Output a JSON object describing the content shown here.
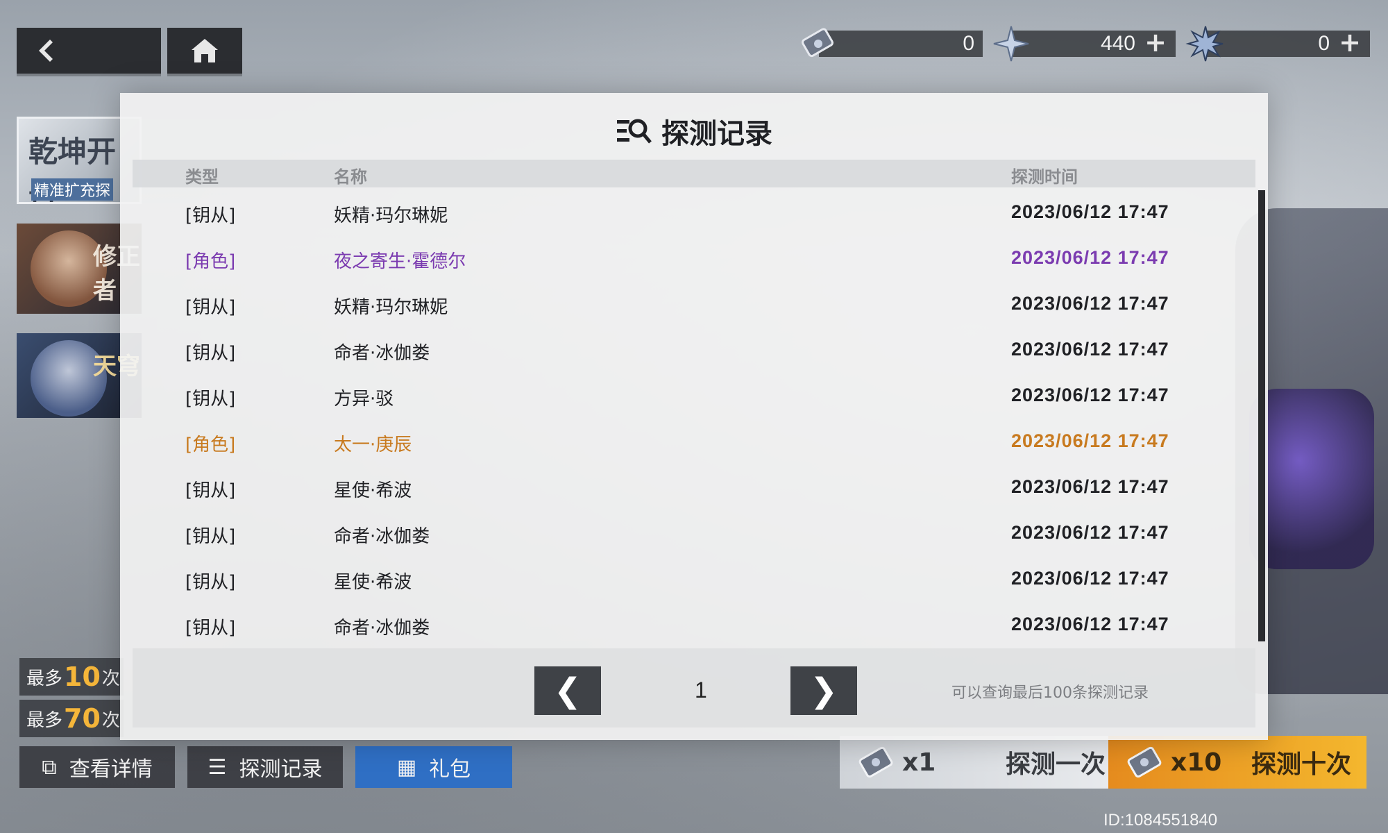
{
  "currencies": [
    {
      "icon": "ticket-icon",
      "amount": "0",
      "has_plus": false
    },
    {
      "icon": "star-crystal-icon",
      "amount": "440",
      "has_plus": true
    },
    {
      "icon": "snowflake-crystal-icon",
      "amount": "0",
      "has_plus": true
    }
  ],
  "banners": {
    "banner1_title": "乾坤开吾",
    "banner1_sub": "精准扩充探",
    "banner2_label": "修正者",
    "banner3_label": "天穹"
  },
  "limits": [
    {
      "prefix": "最多",
      "num": "10",
      "suffix": "次"
    },
    {
      "prefix": "最多",
      "num": "70",
      "suffix": "次"
    }
  ],
  "modal": {
    "title": "探测记录",
    "headers": {
      "type": "类型",
      "name": "名称",
      "time": "探测时间"
    },
    "rows": [
      {
        "type": "[钥从]",
        "name": "妖精·玛尔琳妮",
        "time": "2023/06/12 17:47",
        "color": "default"
      },
      {
        "type": "[角色]",
        "name": "夜之寄生·霍德尔",
        "time": "2023/06/12 17:47",
        "color": "purple"
      },
      {
        "type": "[钥从]",
        "name": "妖精·玛尔琳妮",
        "time": "2023/06/12 17:47",
        "color": "default"
      },
      {
        "type": "[钥从]",
        "name": "命者·冰伽娄",
        "time": "2023/06/12 17:47",
        "color": "default"
      },
      {
        "type": "[钥从]",
        "name": "方异·驳",
        "time": "2023/06/12 17:47",
        "color": "default"
      },
      {
        "type": "[角色]",
        "name": "太一·庚辰",
        "time": "2023/06/12 17:47",
        "color": "orange"
      },
      {
        "type": "[钥从]",
        "name": "星使·希波",
        "time": "2023/06/12 17:47",
        "color": "default"
      },
      {
        "type": "[钥从]",
        "name": "命者·冰伽娄",
        "time": "2023/06/12 17:47",
        "color": "default"
      },
      {
        "type": "[钥从]",
        "name": "星使·希波",
        "time": "2023/06/12 17:47",
        "color": "default"
      },
      {
        "type": "[钥从]",
        "name": "命者·冰伽娄",
        "time": "2023/06/12 17:47",
        "color": "default"
      }
    ],
    "pager": {
      "prev": "❮",
      "next": "❯",
      "page": "1",
      "hint": "可以查询最后100条探测记录"
    }
  },
  "bottom": {
    "detail_label": "查看详情",
    "record_label": "探测记录",
    "gift_label": "礼包",
    "draw_once_count": "x1",
    "draw_once_label": "探测一次",
    "draw_ten_count": "x10",
    "draw_ten_label": "探测十次"
  },
  "user_id": "ID:1084551840",
  "colors": {
    "purple": "#7b3bb0",
    "orange": "#c87a1f",
    "gift_blue": "#2f6fc4",
    "draw_ten": "#f4b72e"
  }
}
